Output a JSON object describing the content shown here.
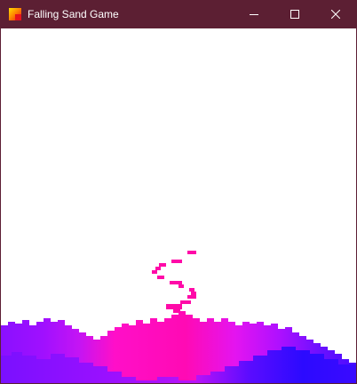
{
  "window": {
    "title": "Falling Sand Game",
    "icon": "sand-app-icon",
    "controls": [
      "minimize-icon",
      "maximize-icon",
      "close-icon"
    ]
  },
  "colors": {
    "titlebar": "#5c1f33",
    "canvas_background": "#ffffff",
    "falling_sand": "#ff0aa8",
    "pink_sand": "#ff0fc8",
    "magenta_sand": "#e414f0",
    "purple_sand": "#a010ff",
    "violet_sand": "#7a10ff",
    "blue_sand": "#3a0aff"
  },
  "simulation": {
    "falling_grains": "falling-sand-stream",
    "settled_pile": "sand-pile"
  }
}
